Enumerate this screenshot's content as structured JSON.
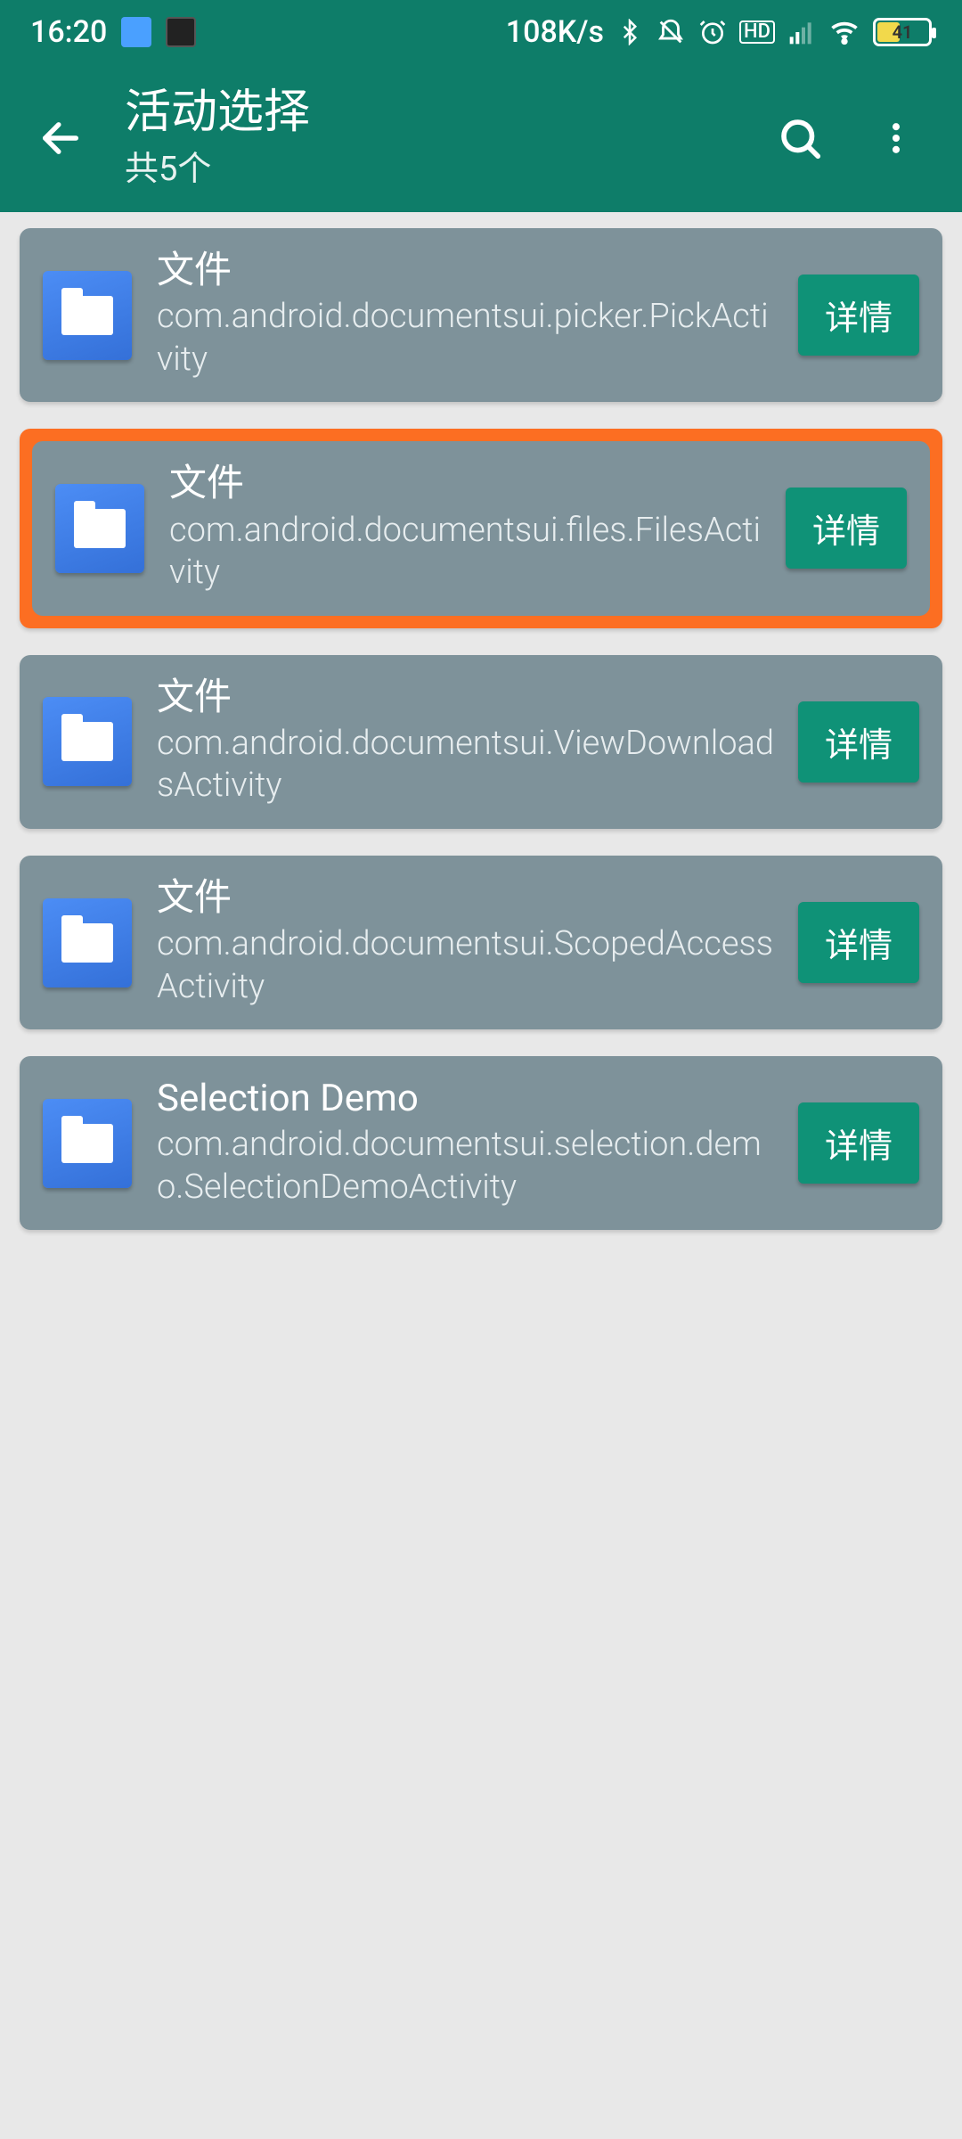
{
  "status": {
    "time": "16:20",
    "net_speed": "108K/s",
    "battery_pct": "41"
  },
  "header": {
    "title": "活动选择",
    "subtitle": "共5个"
  },
  "buttons": {
    "detail": "详情"
  },
  "items": [
    {
      "title": "文件",
      "sub": "com.android.documentsui.picker.PickActivity",
      "selected": false
    },
    {
      "title": "文件",
      "sub": "com.android.documentsui.files.FilesActivity",
      "selected": true
    },
    {
      "title": "文件",
      "sub": "com.android.documentsui.ViewDownloadsActivity",
      "selected": false
    },
    {
      "title": "文件",
      "sub": "com.android.documentsui.ScopedAccessActivity",
      "selected": false
    },
    {
      "title": "Selection Demo",
      "sub": "com.android.documentsui.selection.demo.SelectionDemoActivity",
      "selected": false
    }
  ]
}
